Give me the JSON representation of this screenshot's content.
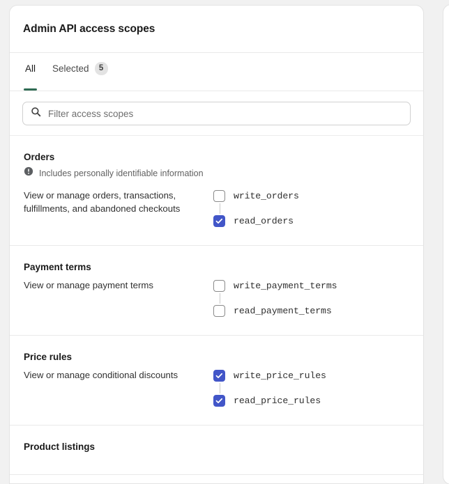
{
  "card": {
    "title": "Admin API access scopes"
  },
  "tabs": [
    {
      "label": "All",
      "badge": null,
      "active": true
    },
    {
      "label": "Selected",
      "badge": "5",
      "active": false
    }
  ],
  "search": {
    "placeholder": "Filter access scopes",
    "value": ""
  },
  "sections": [
    {
      "title": "Orders",
      "pii_note": "Includes personally identifiable information",
      "description": "View or manage orders, transactions, fulfillments, and abandoned checkouts",
      "scopes": [
        {
          "label": "write_orders",
          "checked": false
        },
        {
          "label": "read_orders",
          "checked": true
        }
      ]
    },
    {
      "title": "Payment terms",
      "pii_note": null,
      "description": "View or manage payment terms",
      "scopes": [
        {
          "label": "write_payment_terms",
          "checked": false
        },
        {
          "label": "read_payment_terms",
          "checked": false
        }
      ]
    },
    {
      "title": "Price rules",
      "pii_note": null,
      "description": "View or manage conditional discounts",
      "scopes": [
        {
          "label": "write_price_rules",
          "checked": true
        },
        {
          "label": "read_price_rules",
          "checked": true
        }
      ]
    },
    {
      "title": "Product listings",
      "pii_note": null,
      "description": "",
      "scopes": []
    }
  ],
  "colors": {
    "accent_tab": "#2f6b53",
    "checkbox_checked": "#4256c8",
    "badge_bg": "#e3e3e3",
    "pii_icon": "#5c5f62",
    "scrollbar_thumb": "#b7b7b7"
  }
}
